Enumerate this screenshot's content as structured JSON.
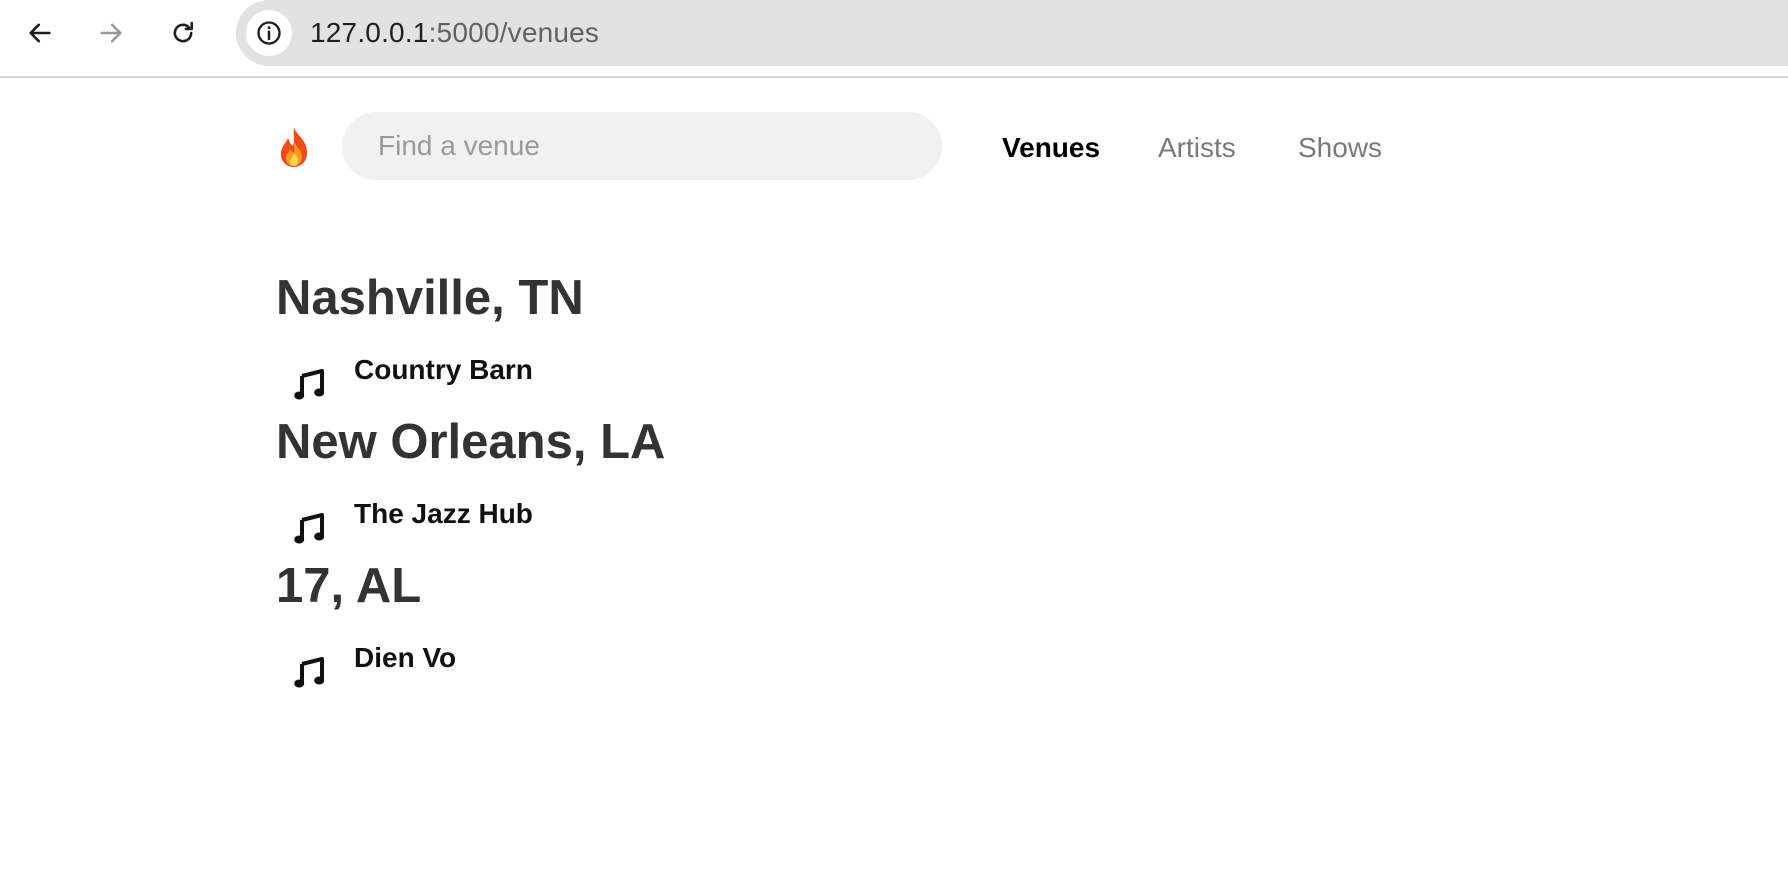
{
  "browser": {
    "url_host": "127.0.0.1",
    "url_path": ":5000/venues"
  },
  "header": {
    "logo_icon": "fire-icon",
    "search_placeholder": "Find a venue",
    "nav": [
      {
        "label": "Venues",
        "active": true
      },
      {
        "label": "Artists",
        "active": false
      },
      {
        "label": "Shows",
        "active": false
      }
    ]
  },
  "cities": [
    {
      "name": "Nashville, TN",
      "venues": [
        {
          "name": "Country Barn",
          "icon": "music-note-icon"
        }
      ]
    },
    {
      "name": "New Orleans, LA",
      "venues": [
        {
          "name": "The Jazz Hub",
          "icon": "music-note-icon"
        }
      ]
    },
    {
      "name": "17, AL",
      "venues": [
        {
          "name": "Dien Vo",
          "icon": "music-note-icon"
        }
      ]
    }
  ]
}
